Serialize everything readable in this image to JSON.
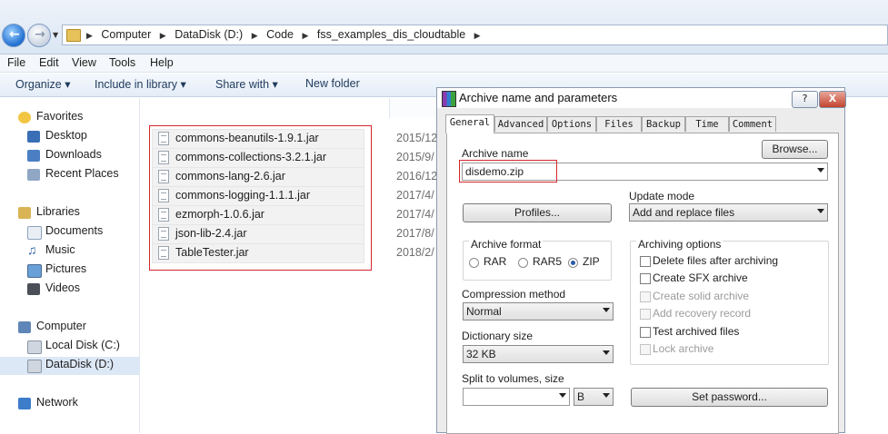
{
  "explorer": {
    "path": [
      "Computer",
      "DataDisk (D:)",
      "Code",
      "fss_examples_dis_cloudtable"
    ],
    "menu": [
      "File",
      "Edit",
      "View",
      "Tools",
      "Help"
    ],
    "commands": {
      "organize": "Organize ▾",
      "include": "Include in library ▾",
      "share": "Share with ▾",
      "newfolder": "New folder"
    },
    "nav": {
      "favorites": "Favorites",
      "desktop": "Desktop",
      "downloads": "Downloads",
      "recent": "Recent Places",
      "libraries": "Libraries",
      "documents": "Documents",
      "music": "Music",
      "pictures": "Pictures",
      "videos": "Videos",
      "computer": "Computer",
      "localdisk": "Local Disk (C:)",
      "datadisk": "DataDisk (D:)",
      "network": "Network"
    },
    "files": [
      {
        "name": "commons-beanutils-1.9.1.jar",
        "date": "2015/12"
      },
      {
        "name": "commons-collections-3.2.1.jar",
        "date": "2015/9/"
      },
      {
        "name": "commons-lang-2.6.jar",
        "date": "2016/12"
      },
      {
        "name": "commons-logging-1.1.1.jar",
        "date": "2017/4/"
      },
      {
        "name": "ezmorph-1.0.6.jar",
        "date": "2017/4/"
      },
      {
        "name": "json-lib-2.4.jar",
        "date": "2017/8/"
      },
      {
        "name": "TableTester.jar",
        "date": "2018/2/"
      }
    ]
  },
  "dialog": {
    "title": "Archive name and parameters",
    "help": "?",
    "close": "X",
    "tabs": [
      "General",
      "Advanced",
      "Options",
      "Files",
      "Backup",
      "Time",
      "Comment"
    ],
    "browse": "Browse...",
    "archive_name_label": "Archive name",
    "archive_name": "disdemo.zip",
    "update_mode_label": "Update mode",
    "update_mode": "Add and replace files",
    "profiles": "Profiles...",
    "archive_format_label": "Archive format",
    "formats": [
      "RAR",
      "RAR5",
      "ZIP"
    ],
    "compression_label": "Compression method",
    "compression": "Normal",
    "dictionary_label": "Dictionary size",
    "dictionary": "32 KB",
    "split_label": "Split to volumes, size",
    "split_unit": "B",
    "options_label": "Archiving options",
    "options": [
      {
        "label": "Delete files after archiving",
        "enabled": true
      },
      {
        "label": "Create SFX archive",
        "enabled": true
      },
      {
        "label": "Create solid archive",
        "enabled": false
      },
      {
        "label": "Add recovery record",
        "enabled": false
      },
      {
        "label": "Test archived files",
        "enabled": true
      },
      {
        "label": "Lock archive",
        "enabled": false
      }
    ],
    "set_password": "Set password..."
  }
}
